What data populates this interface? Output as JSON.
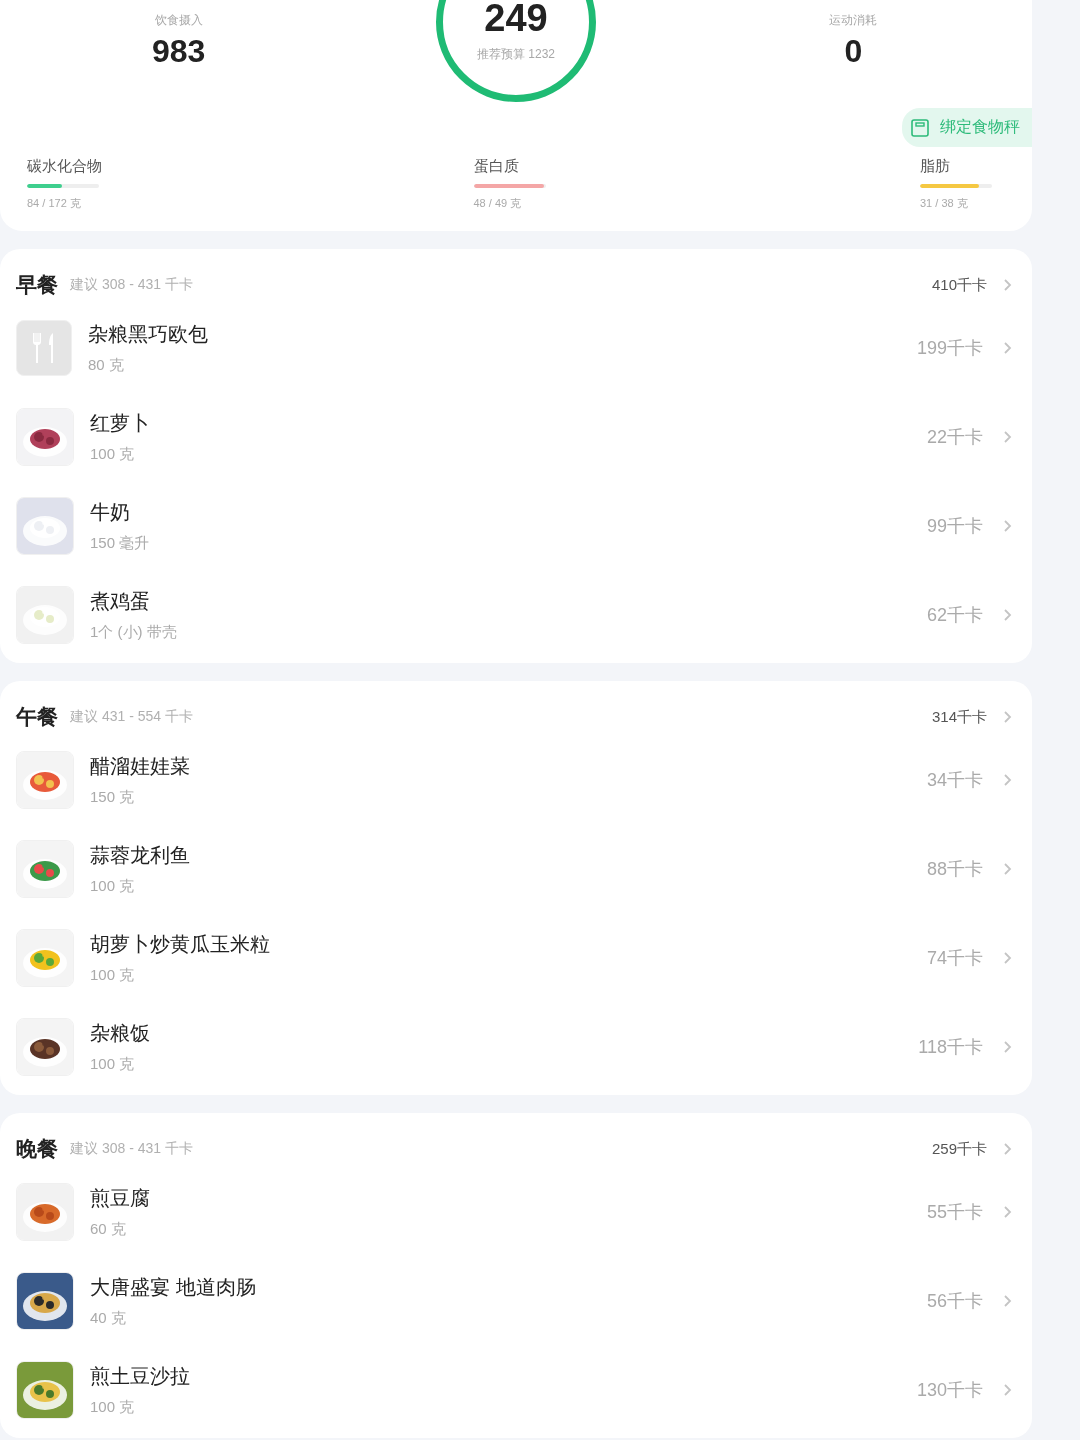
{
  "summary": {
    "intake": {
      "label": "饮食摄入",
      "value": "983"
    },
    "remaining": {
      "value": "249",
      "budget": "推荐预算 1232"
    },
    "exercise": {
      "label": "运动消耗",
      "value": "0"
    },
    "scale_button": "绑定食物秤"
  },
  "macros": [
    {
      "name": "碳水化合物",
      "amount": "84 / 172 克",
      "level": 0.49,
      "color": "#3ecf8e"
    },
    {
      "name": "蛋白质",
      "amount": "48 / 49 克",
      "level": 0.98,
      "color": "#f4a6a6"
    },
    {
      "name": "脂肪",
      "amount": "31 / 38 克",
      "level": 0.82,
      "color": "#f5c842"
    }
  ],
  "meals": [
    {
      "name": "早餐",
      "suggestion": "建议 308 - 431 千卡",
      "total": "410千卡",
      "foods": [
        {
          "name": "杂粮黑巧欧包",
          "portion": "80 克",
          "calories": "199千卡",
          "kind": "placeholder"
        },
        {
          "name": "红萝卜",
          "portion": "100 克",
          "calories": "22千卡",
          "kind": "picture"
        },
        {
          "name": "牛奶",
          "portion": "150 毫升",
          "calories": "99千卡",
          "kind": "picture"
        },
        {
          "name": "煮鸡蛋",
          "portion": "1个 (小) 带壳",
          "calories": "62千卡",
          "kind": "picture"
        }
      ]
    },
    {
      "name": "午餐",
      "suggestion": "建议 431 - 554 千卡",
      "total": "314千卡",
      "foods": [
        {
          "name": "醋溜娃娃菜",
          "portion": "150 克",
          "calories": "34千卡",
          "kind": "picture"
        },
        {
          "name": "蒜蓉龙利鱼",
          "portion": "100 克",
          "calories": "88千卡",
          "kind": "picture"
        },
        {
          "name": "胡萝卜炒黄瓜玉米粒",
          "portion": "100 克",
          "calories": "74千卡",
          "kind": "picture"
        },
        {
          "name": "杂粮饭",
          "portion": "100 克",
          "calories": "118千卡",
          "kind": "picture"
        }
      ]
    },
    {
      "name": "晚餐",
      "suggestion": "建议 308 - 431 千卡",
      "total": "259千卡",
      "foods": [
        {
          "name": "煎豆腐",
          "portion": "60 克",
          "calories": "55千卡",
          "kind": "picture"
        },
        {
          "name": "大唐盛宴 地道肉肠",
          "portion": "40 克",
          "calories": "56千卡",
          "kind": "picture"
        },
        {
          "name": "煎土豆沙拉",
          "portion": "100 克",
          "calories": "130千卡",
          "kind": "picture"
        }
      ]
    }
  ]
}
